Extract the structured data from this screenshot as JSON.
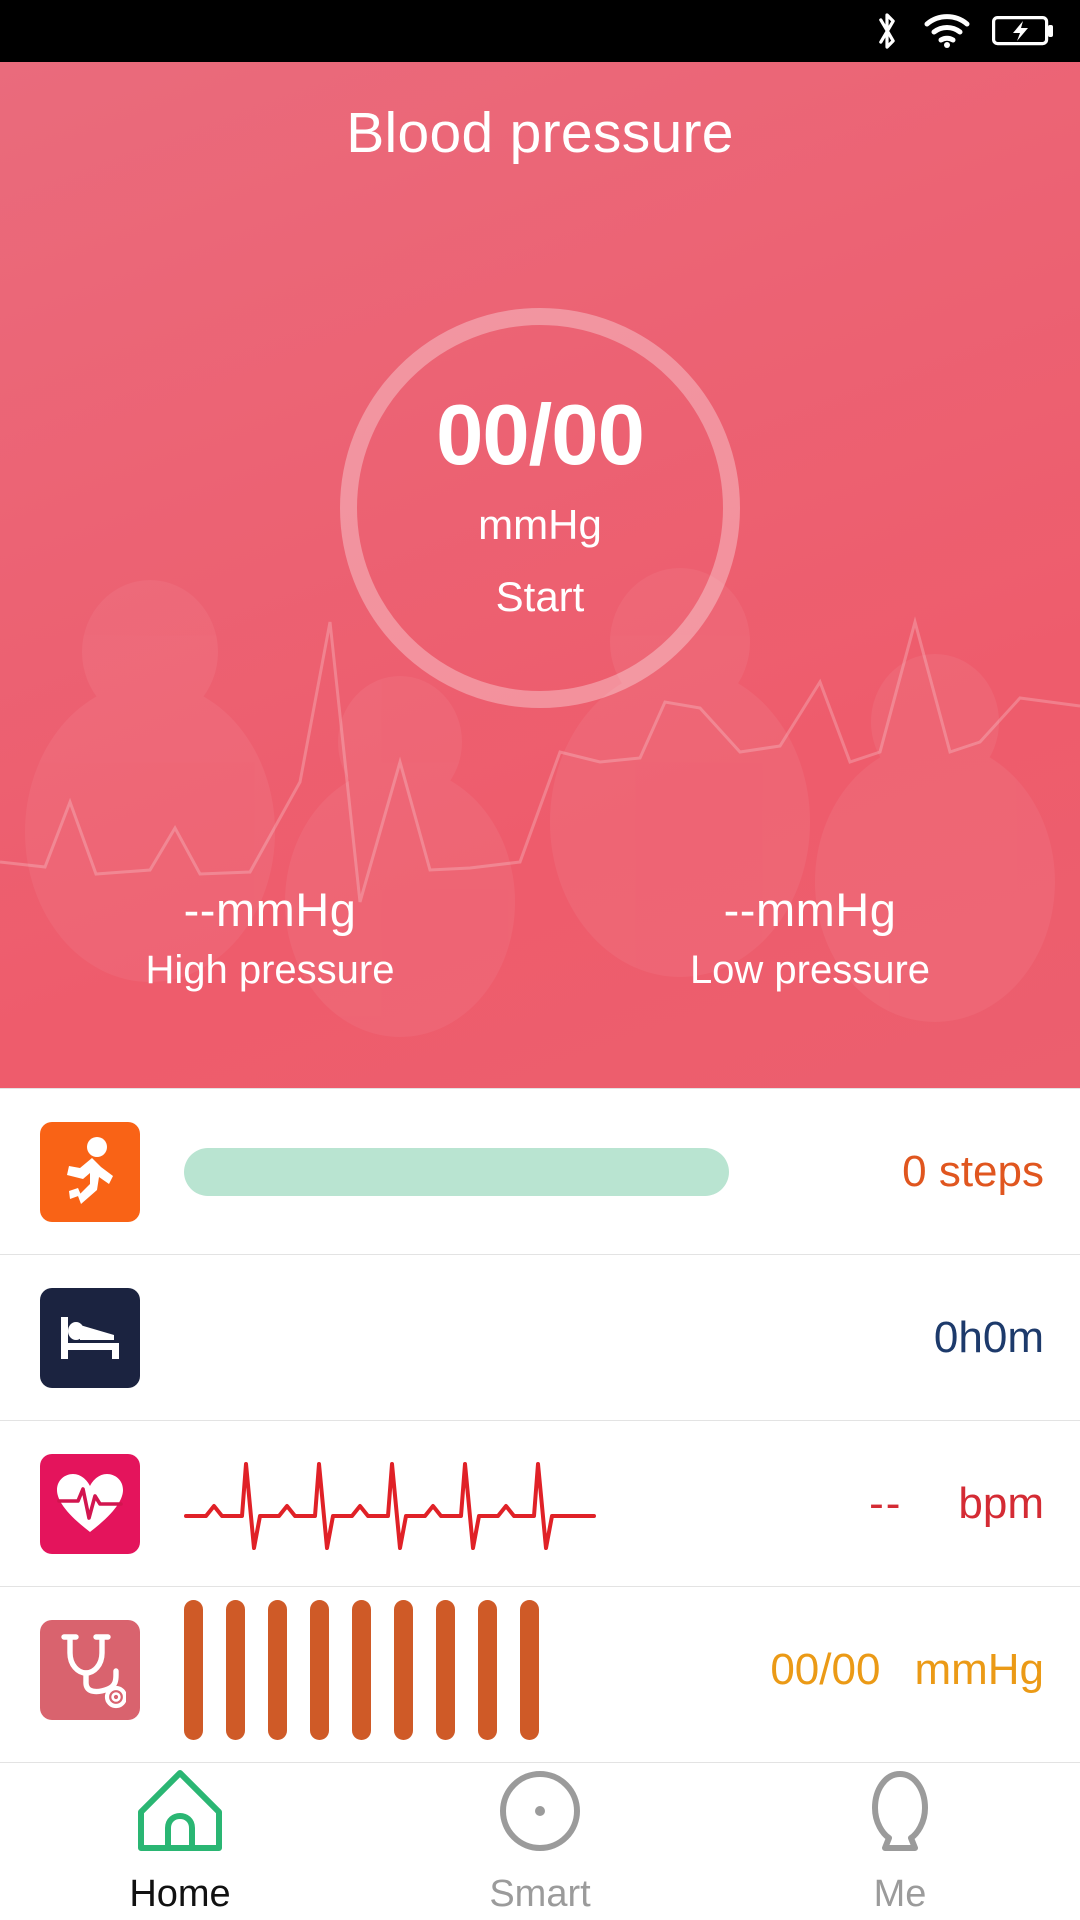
{
  "statusbar": {
    "icons": [
      "bluetooth-icon",
      "wifi-icon",
      "battery-charging-icon"
    ]
  },
  "hero": {
    "title": "Blood pressure",
    "gauge": {
      "value": "00/00",
      "unit": "mmHg",
      "action": "Start"
    },
    "readings": [
      {
        "value": "--mmHg",
        "label": "High pressure"
      },
      {
        "value": "--mmHg",
        "label": "Low pressure"
      }
    ],
    "background_color": "#ec5f6e",
    "ring_color": "#f5a0a9"
  },
  "rows": [
    {
      "name": "steps",
      "icon": "running-icon",
      "tile_color": "#f96316",
      "value": "0 steps",
      "value_color": "#e0561f",
      "progress_color": "#b9e4d1",
      "progress_percent": 0
    },
    {
      "name": "sleep",
      "icon": "bed-icon",
      "tile_color": "#1b2340",
      "value": "0h0m",
      "value_color": "#1d3a6b"
    },
    {
      "name": "heart-rate",
      "icon": "heart-pulse-icon",
      "tile_color": "#e4145c",
      "value": "--",
      "unit": "bpm",
      "value_color": "#d42b34"
    },
    {
      "name": "blood-pressure",
      "icon": "stethoscope-icon",
      "tile_color": "#d9636e",
      "value": "00/00",
      "unit": "mmHg",
      "value_color": "#eb9a16",
      "bar_color": "#cf5a27",
      "bar_count": 9
    }
  ],
  "bottomnav": {
    "items": [
      {
        "label": "Home",
        "icon": "home-icon",
        "active": true,
        "color": "#2ab673"
      },
      {
        "label": "Smart",
        "icon": "circle-dot-icon",
        "active": false,
        "color": "#9b9b9b"
      },
      {
        "label": "Me",
        "icon": "person-icon",
        "active": false,
        "color": "#9b9b9b"
      }
    ]
  }
}
